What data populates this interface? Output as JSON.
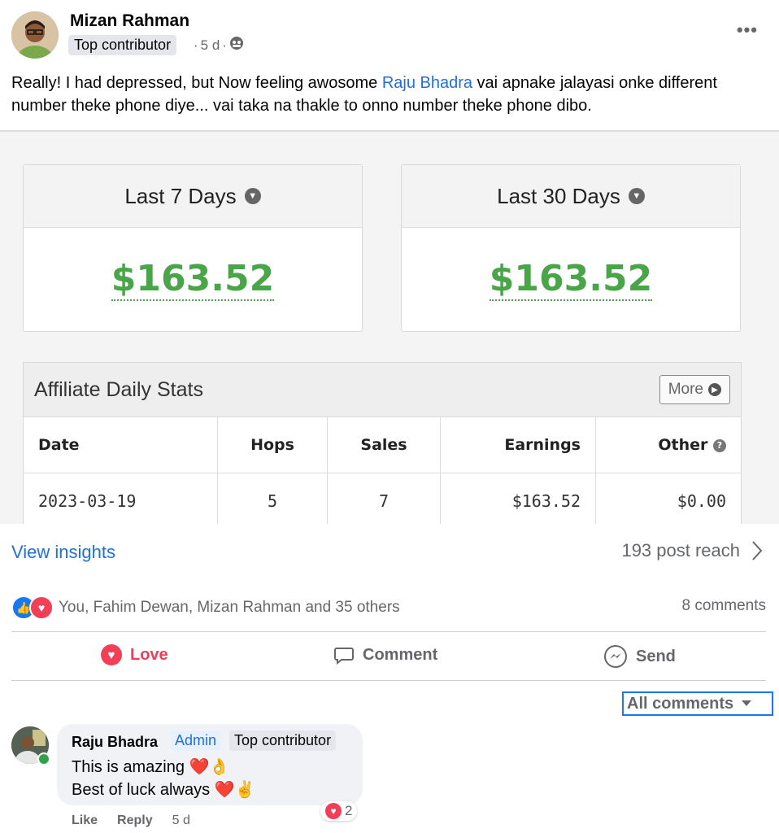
{
  "post": {
    "author": "Mizan Rahman",
    "badge": "Top contributor",
    "time": "5 d",
    "text_before": "Really! I had depressed, but Now feeling awosome ",
    "mention": "Raju Bhadra",
    "text_after": " vai apnake jalayasi onke different number theke phone diye... vai taka na thakle to onno number theke phone dibo."
  },
  "image": {
    "card1_title": "Last 7 Days",
    "card1_value": "$163.52",
    "card2_title": "Last 30 Days",
    "card2_value": "$163.52",
    "table_title": "Affiliate Daily Stats",
    "more_label": "More",
    "headers": [
      "Date",
      "Hops",
      "Sales",
      "Earnings",
      "Other"
    ],
    "rows": [
      [
        "2023-03-19",
        "5",
        "7",
        "$163.52",
        "$0.00"
      ]
    ]
  },
  "stats": {
    "view_insights": "View insights",
    "reach": "193 post reach",
    "reactions_text": "You, Fahim Dewan, Mizan Rahman and 35 others",
    "comments_count": "8 comments"
  },
  "actions": {
    "love": "Love",
    "comment": "Comment",
    "send": "Send"
  },
  "comments_filter": "All comments",
  "comment": {
    "author": "Raju Bhadra",
    "admin_badge": "Admin",
    "top_badge": "Top contributor",
    "line1": "This is amazing ❤️👌",
    "line2": "Best of luck always ❤️✌️",
    "reaction_count": "2",
    "like": "Like",
    "reply": "Reply",
    "time": "5 d"
  },
  "colors": {
    "accent_blue": "#216fdb",
    "love_red": "#f33e58",
    "money_green": "#4aa549"
  }
}
